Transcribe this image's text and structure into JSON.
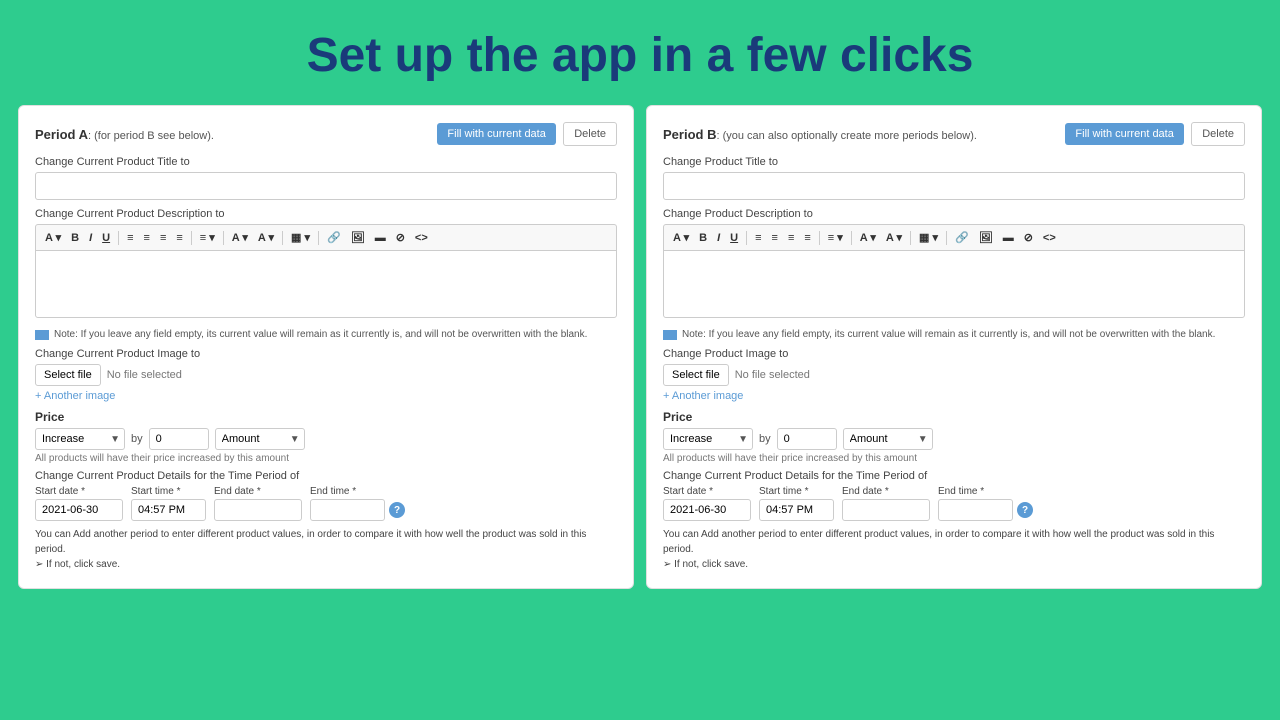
{
  "header": {
    "title": "Set up the app in a few clicks"
  },
  "panel_a": {
    "title": "Period A",
    "title_suffix": ": (for period B see below).",
    "btn_fill": "Fill with current data",
    "btn_delete": "Delete",
    "field_title_label": "Change Current Product Title to",
    "field_description_label": "Change Current Product Description to",
    "note_text": "Note: If you leave any field empty, its current value will remain as it currently is, and will not be overwritten with the blank.",
    "image_label": "Change Current Product Image to",
    "btn_select_file": "Select file",
    "file_none": "No file selected",
    "another_image": "+ Another image",
    "price_label": "Price",
    "price_increase": "Increase",
    "price_by": "by",
    "price_amount_value": "0",
    "price_amount": "Amount",
    "price_note": "All products will have their price increased by this amount",
    "time_period_label": "Change Current Product Details for the Time Period of",
    "start_date_label": "Start date *",
    "start_date_value": "2021-06-30",
    "start_time_label": "Start time *",
    "start_time_value": "04:57 PM",
    "end_date_label": "End date *",
    "end_date_value": "",
    "end_time_label": "End time *",
    "end_time_value": "",
    "bottom_note": "You can Add another period to enter different product values, in order to compare it with how well the product was sold in this period.",
    "bottom_note2": "➢  If not, click save."
  },
  "panel_b": {
    "title": "Period B",
    "title_suffix": ": (you can also optionally create more periods below).",
    "btn_fill": "Fill with current data",
    "btn_delete": "Delete",
    "field_title_label": "Change Product Title to",
    "field_description_label": "Change Product Description to",
    "note_text": "Note: If you leave any field empty, its current value will remain as it currently is, and will not be overwritten with the blank.",
    "image_label": "Change Product Image to",
    "btn_select_file": "Select file",
    "file_none": "No file selected",
    "another_image": "+ Another image",
    "price_label": "Price",
    "price_increase": "Increase",
    "price_by": "by",
    "price_amount_value": "0",
    "price_amount": "Amount",
    "price_note": "All products will have their price increased by this amount",
    "time_period_label": "Change Current Product Details for the Time Period of",
    "start_date_label": "Start date *",
    "start_date_value": "2021-06-30",
    "start_time_label": "Start time *",
    "start_time_value": "04:57 PM",
    "end_date_label": "End date *",
    "end_date_value": "",
    "end_time_label": "End time *",
    "end_time_value": "",
    "bottom_note": "You can Add another period to enter different product values, in order to compare it with how well the product was sold in this period.",
    "bottom_note2": "➢  If not, click save."
  },
  "toolbar_buttons": [
    "A",
    "B",
    "I",
    "U",
    "≡",
    "≡",
    "≡",
    "≡",
    "≡",
    "A",
    "A",
    "▦",
    "🔗",
    "🖼",
    "▬",
    "⊘",
    "<>"
  ]
}
